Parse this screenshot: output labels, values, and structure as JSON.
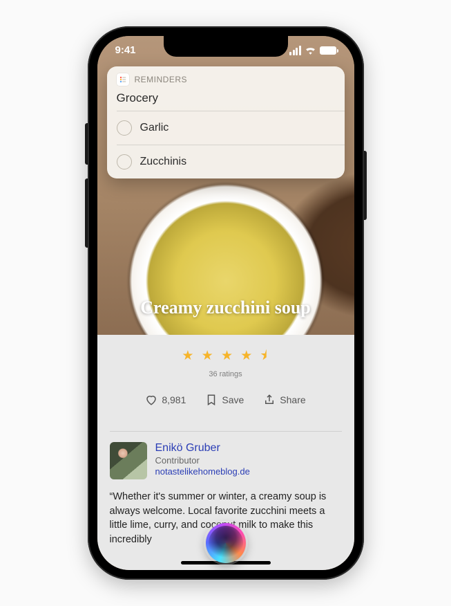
{
  "status": {
    "time": "9:41"
  },
  "reminders": {
    "app_label": "REMINDERS",
    "list_title": "Grocery",
    "items": [
      "Garlic",
      "Zucchinis"
    ]
  },
  "hero": {
    "title": "Creamy zucchini soup"
  },
  "rating": {
    "stars_display": "★ ★ ★ ★ ⯨",
    "count_text": "36 ratings"
  },
  "actions": {
    "likes": "8,981",
    "save_label": "Save",
    "share_label": "Share"
  },
  "author": {
    "name": "Enikö Gruber",
    "role": "Contributor",
    "link": "notastelikehomeblog.de"
  },
  "description": "“Whether it's summer or winter, a creamy soup is always welcome. Local favorite zucchini meets a little lime, curry, and coconut milk to make this incredibly"
}
